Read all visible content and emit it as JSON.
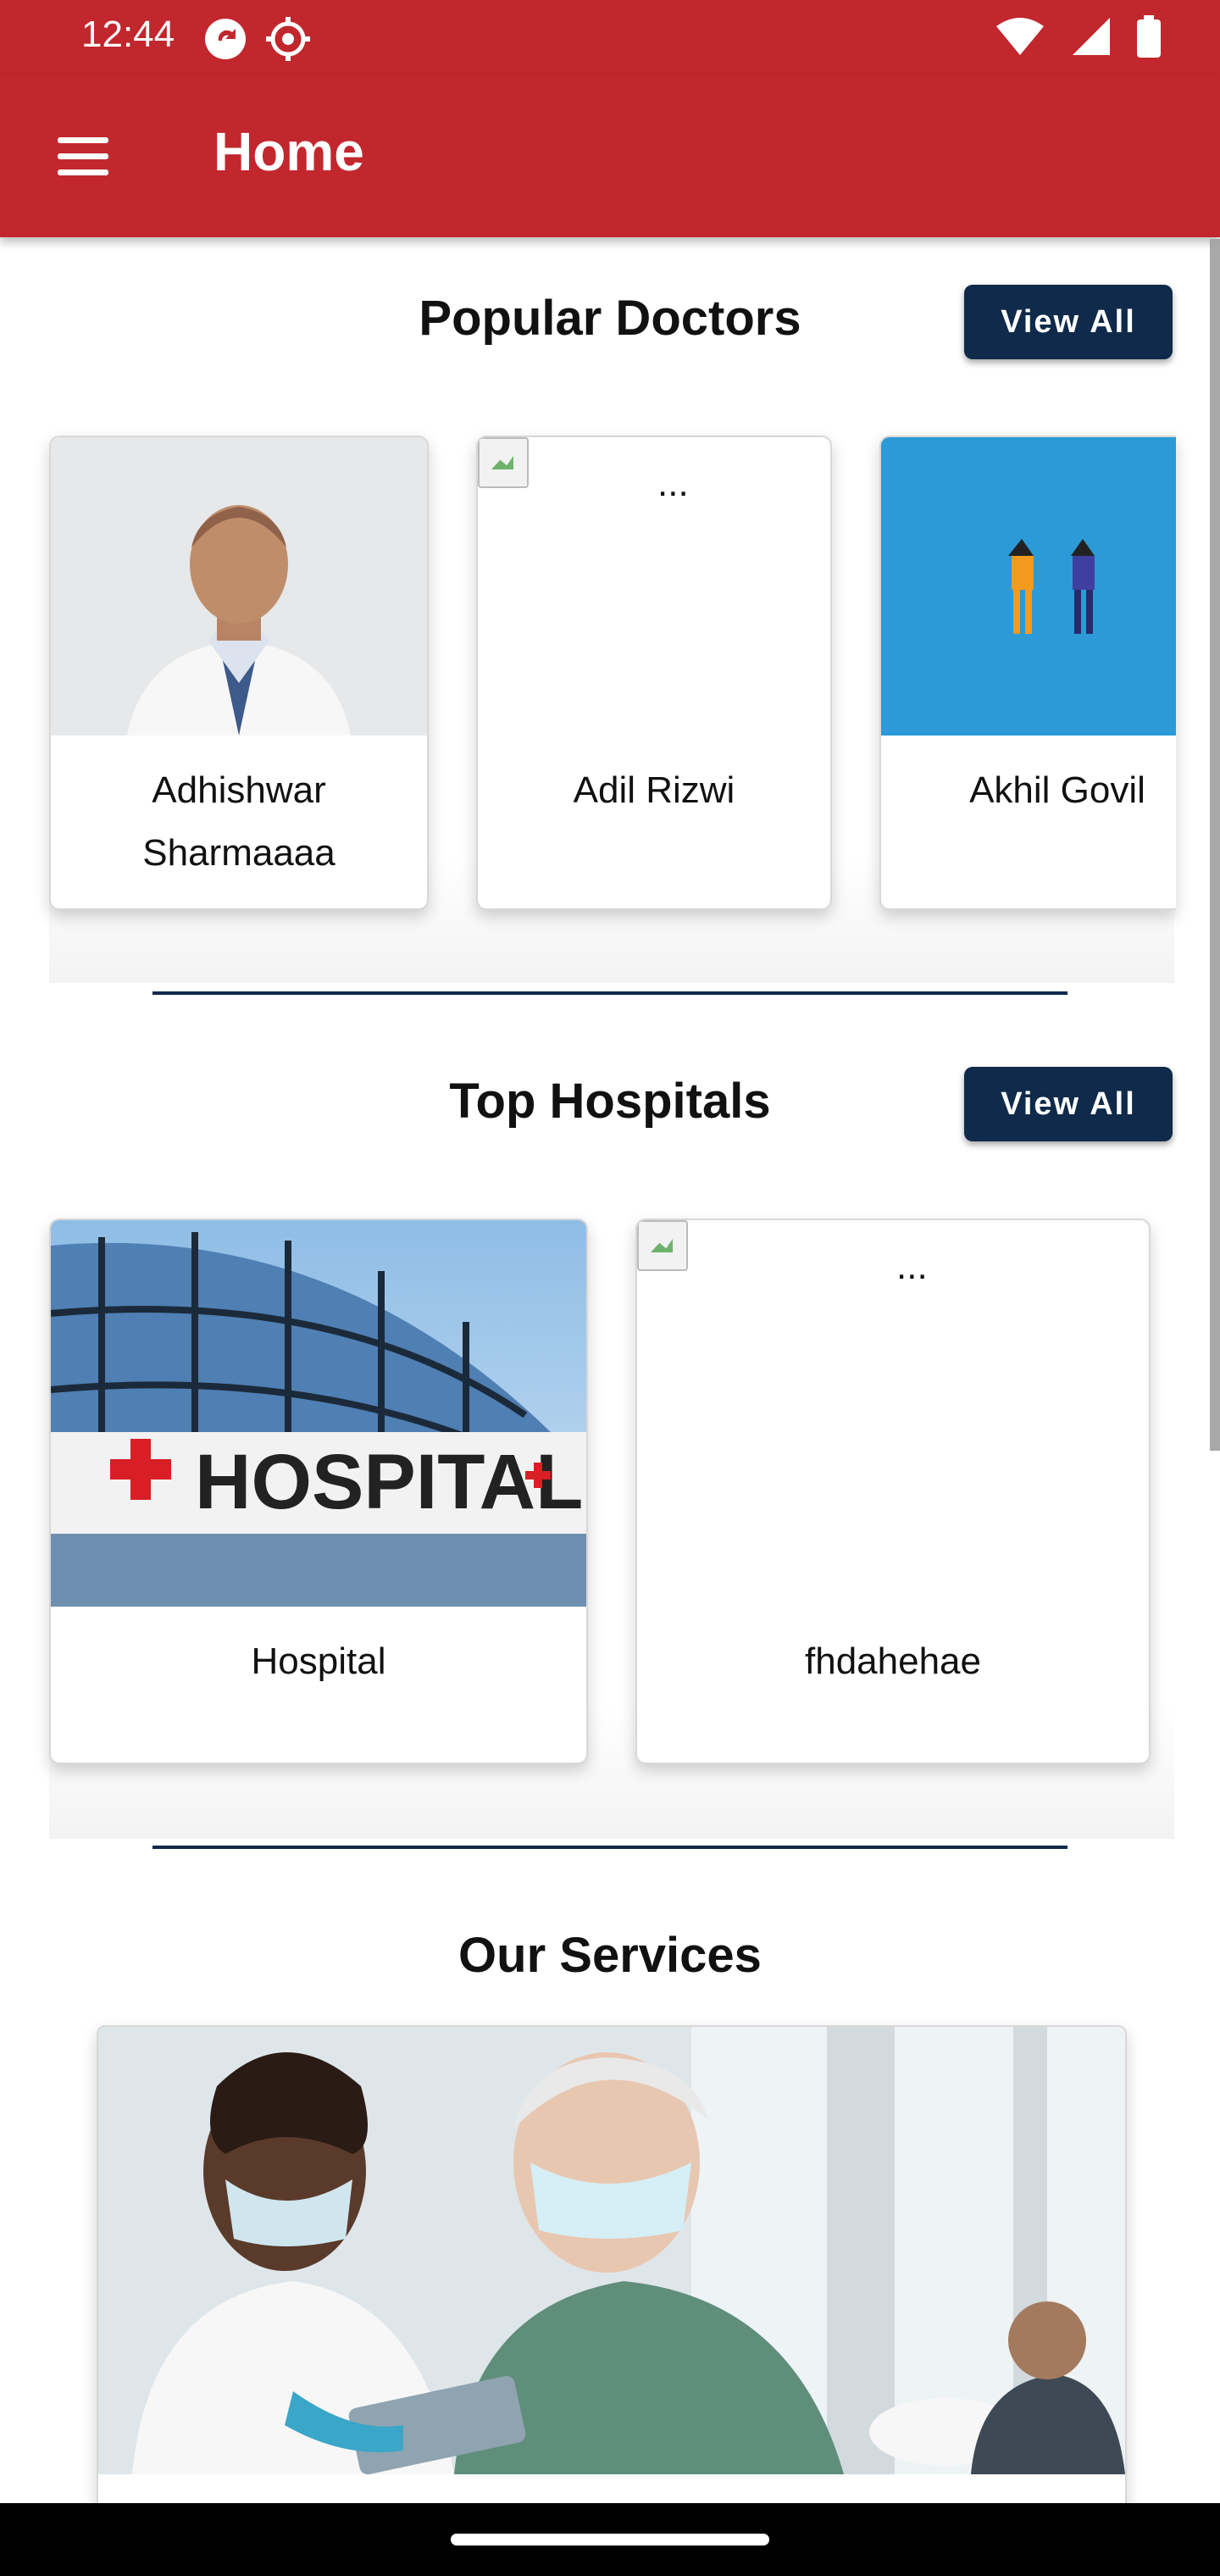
{
  "status_bar": {
    "time": "12:44"
  },
  "app_bar": {
    "title": "Home"
  },
  "popular_doctors": {
    "title": "Popular Doctors",
    "view_all_label": "View All",
    "cards": [
      {
        "name": "Adhishwar Sharmaaaa"
      },
      {
        "name": "Adil Rizwi",
        "placeholder": "..."
      },
      {
        "name": "Akhil Govil"
      }
    ]
  },
  "top_hospitals": {
    "title": "Top Hospitals",
    "view_all_label": "View All",
    "cards": [
      {
        "name": "Hospital"
      },
      {
        "name": "fhdahehae",
        "placeholder": "..."
      }
    ]
  },
  "our_services": {
    "title": "Our Services"
  },
  "colors": {
    "primary": "#c1272d",
    "accent": "#0f2a4a"
  }
}
